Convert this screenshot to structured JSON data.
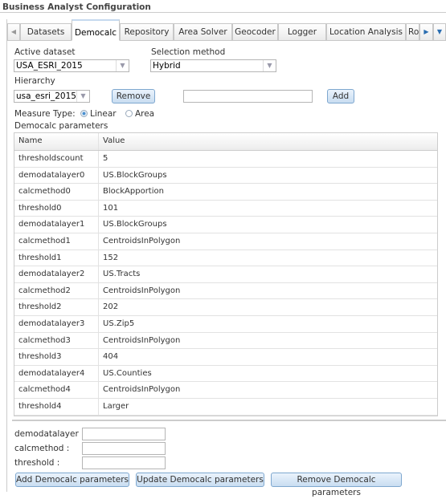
{
  "title": "Business Analyst Configuration",
  "tabs": [
    "Datasets",
    "Democalc",
    "Repository",
    "Area Solver",
    "Geocoder",
    "Logger",
    "Location Analysis",
    "Ro"
  ],
  "active_tab": "Democalc",
  "form": {
    "active_dataset_label": "Active dataset",
    "active_dataset_value": "USA_ESRI_2015",
    "selection_method_label": "Selection method",
    "selection_method_value": "Hybrid",
    "hierarchy_label": "Hierarchy",
    "hierarchy_value": "usa_esri_2015",
    "remove_label": "Remove",
    "add_label": "Add",
    "new_hierarchy_value": "",
    "measure_type_label": "Measure Type:",
    "linear_label": "Linear",
    "area_label": "Area",
    "measure_type_selected": "Linear",
    "params_label": "Democalc parameters"
  },
  "grid": {
    "columns": [
      "Name",
      "Value"
    ],
    "rows": [
      [
        "thresholdscount",
        "5"
      ],
      [
        "demodatalayer0",
        "US.BlockGroups"
      ],
      [
        "calcmethod0",
        "BlockApportion"
      ],
      [
        "threshold0",
        "101"
      ],
      [
        "demodatalayer1",
        "US.BlockGroups"
      ],
      [
        "calcmethod1",
        "CentroidsInPolygon"
      ],
      [
        "threshold1",
        "152"
      ],
      [
        "demodatalayer2",
        "US.Tracts"
      ],
      [
        "calcmethod2",
        "CentroidsInPolygon"
      ],
      [
        "threshold2",
        "202"
      ],
      [
        "demodatalayer3",
        "US.Zip5"
      ],
      [
        "calcmethod3",
        "CentroidsInPolygon"
      ],
      [
        "threshold3",
        "404"
      ],
      [
        "demodatalayer4",
        "US.Counties"
      ],
      [
        "calcmethod4",
        "CentroidsInPolygon"
      ],
      [
        "threshold4",
        "Larger"
      ]
    ]
  },
  "editor": {
    "demodatalayer_label": "demodatalayer :",
    "calcmethod_label": "calcmethod :",
    "threshold_label": "threshold :",
    "add_btn": "Add Democalc parameters",
    "update_btn": "Update Democalc parameters",
    "remove_btn": "Remove Democalc parameters"
  }
}
